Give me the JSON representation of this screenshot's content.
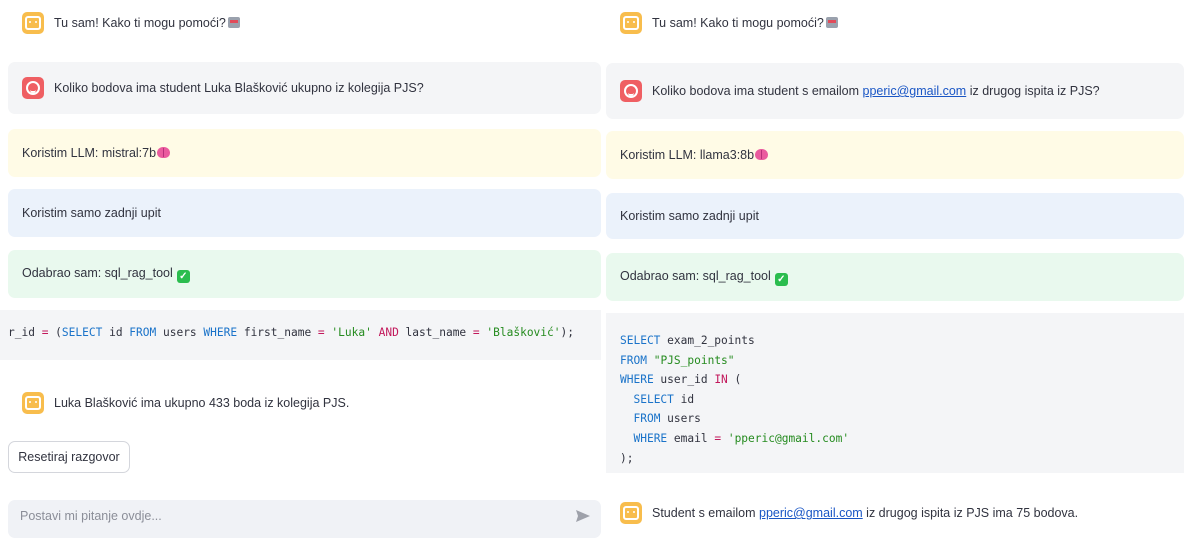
{
  "left": {
    "greeting": "Tu sam! Kako ti mogu pomoći?",
    "question": "Koliko bodova ima student Luka Blašković ukupno iz kolegija PJS?",
    "llm_text": "Koristim LLM: mistral:7b",
    "context_text": "Koristim samo zadnji upit",
    "tool_text": "Odabrao sam: sql_rag_tool",
    "code": {
      "t1": "r_id ",
      "t2": "=",
      "t3": " (",
      "t4": "SELECT",
      "t5": " id ",
      "t6": "FROM",
      "t7": " users ",
      "t8": "WHERE",
      "t9": " first_name ",
      "t10": "=",
      "t11": " ",
      "t12": "'Luka'",
      "t13": " ",
      "t14": "AND",
      "t15": " last_name ",
      "t16": "=",
      "t17": " ",
      "t18": "'Blašković'",
      "t19": ");"
    },
    "answer": "Luka Blašković ima ukupno 433 boda iz kolegija PJS.",
    "reset_button": "Resetiraj razgovor",
    "input_placeholder": "Postavi mi pitanje ovdje..."
  },
  "right": {
    "greeting": "Tu sam! Kako ti mogu pomoći?",
    "question_pre": "Koliko bodova ima student s emailom ",
    "question_link": "pperic@gmail.com",
    "question_post": " iz drugog ispita iz PJS?",
    "llm_text": "Koristim LLM: llama3:8b",
    "context_text": "Koristim samo zadnji upit",
    "tool_text": "Odabrao sam: sql_rag_tool",
    "code": {
      "l1a": "SELECT",
      "l1b": " exam_2_points",
      "l2a": "FROM",
      "l2b": " ",
      "l2c": "\"PJS_points\"",
      "l3a": "WHERE",
      "l3b": " user_id ",
      "l3c": "IN",
      "l3d": " (",
      "l4a": "  ",
      "l4b": "SELECT",
      "l4c": " id",
      "l5a": "  ",
      "l5b": "FROM",
      "l5c": " users",
      "l6a": "  ",
      "l6b": "WHERE",
      "l6c": " email ",
      "l6d": "=",
      "l6e": " ",
      "l6f": "'pperic@gmail.com'",
      "l7": ");"
    },
    "answer_pre": "Student s emailom ",
    "answer_link": "pperic@gmail.com",
    "answer_post": " iz drugog ispita iz PJS ima 75 bodova."
  },
  "icons": {
    "assistant_avatar": "bot-icon",
    "user_avatar": "user-icon",
    "brain": "brain-emoji",
    "check": "check-emoji",
    "robot": "robot-emoji",
    "send": "send-icon"
  },
  "colors": {
    "assistant_avatar": "#f8bd4d",
    "user_avatar": "#ef5f63",
    "llm_box": "#fffbe6",
    "context_box": "#ebf2fb",
    "tool_box": "#e9f9ee",
    "message_box": "#f4f5f7",
    "sql_keyword": "#1a73c9",
    "sql_string": "#258b1f",
    "sql_operator": "#c2185b"
  }
}
